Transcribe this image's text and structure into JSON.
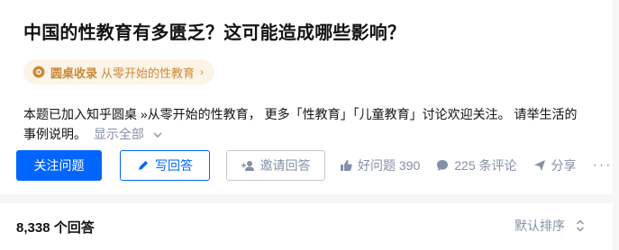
{
  "question": {
    "title": "中国的性教育有多匮乏？这可能造成哪些影响？"
  },
  "roundtable": {
    "label": "圆桌收录",
    "name": "从零开始的性教育",
    "arrow": "›",
    "icon": "roundtable-icon"
  },
  "description": {
    "line1": "本题已加入知乎圆桌 »从零开始的性教育， 更多「性教育」「儿童教育」讨论欢迎关注。 请举生活的",
    "line2": "事例说明。",
    "show_all": "显示全部",
    "show_all_icon": "chevron-down-icon"
  },
  "actions": {
    "follow_label": "关注问题",
    "answer_label": "写回答",
    "invite_label": "邀请回答",
    "good_question_label": "好问题 390",
    "comments_label": "225 条评论",
    "share_label": "分享",
    "more_label": "···"
  },
  "answers": {
    "count_label": "8,338 个回答",
    "sort_label": "默认排序"
  },
  "colors": {
    "primary": "#0066ff",
    "muted": "#8590a6",
    "roundtable_bg": "#fdf4e8",
    "roundtable_text": "#c98a3a"
  }
}
